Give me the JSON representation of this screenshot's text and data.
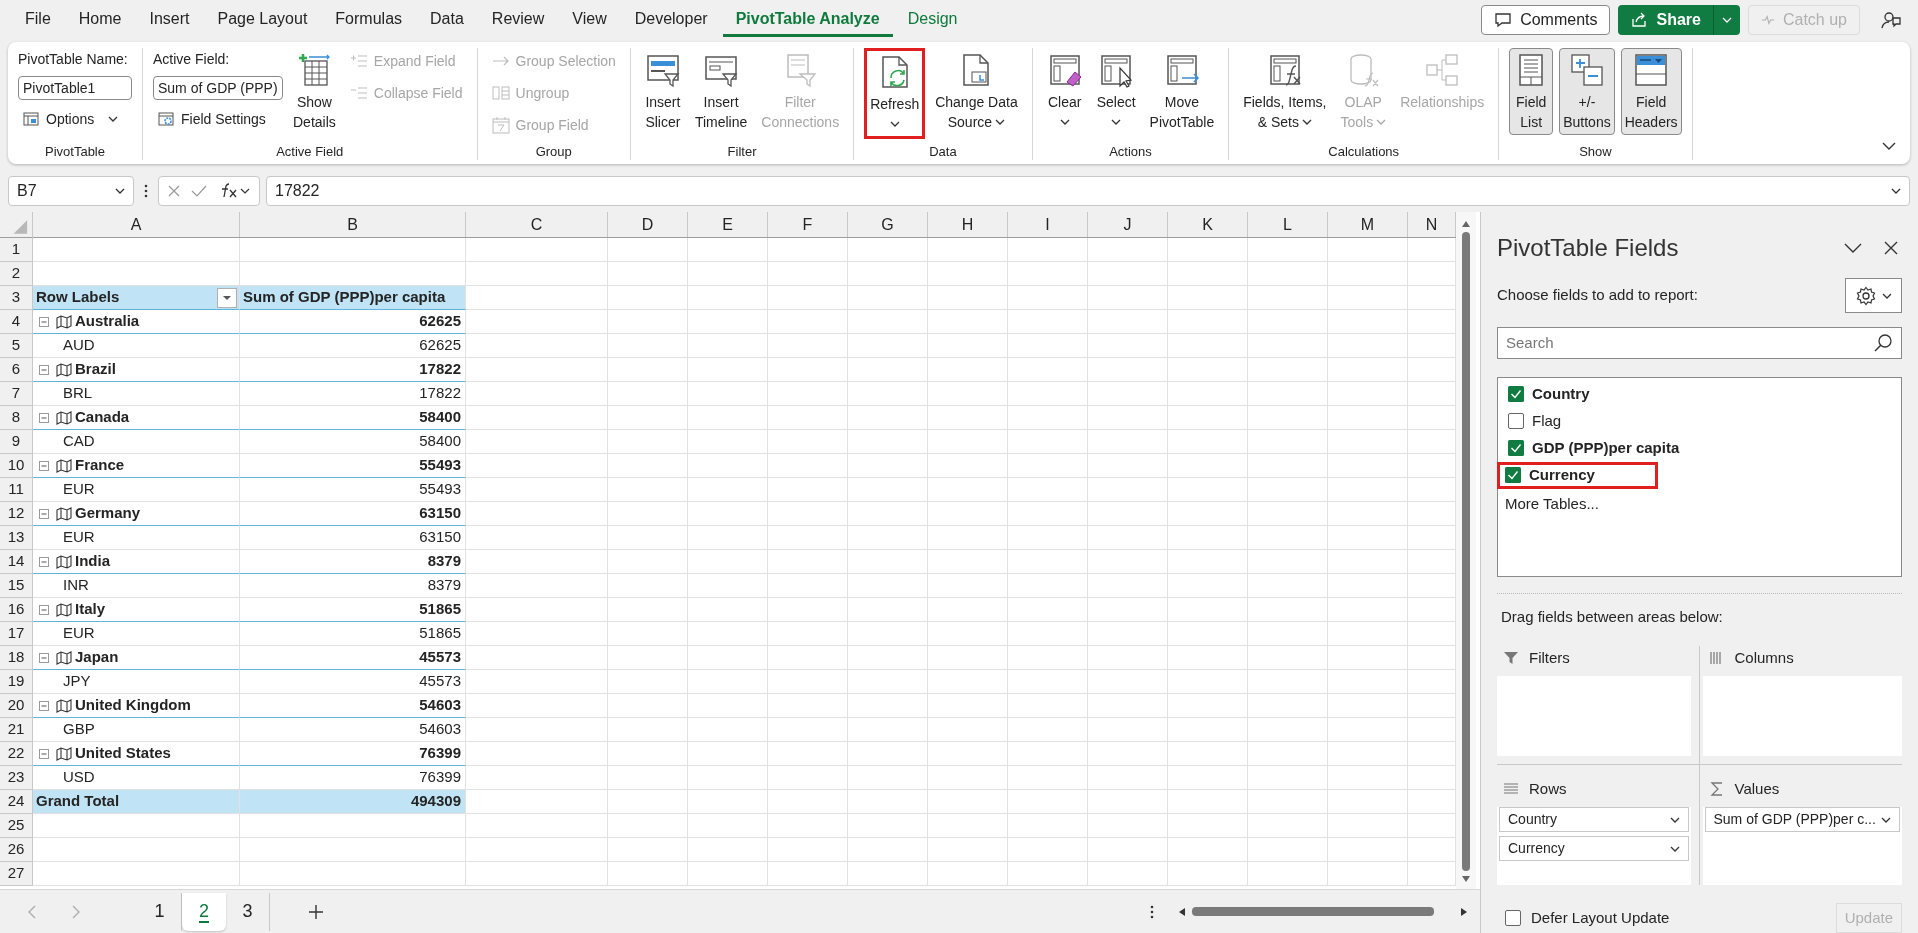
{
  "menu_tabs": [
    {
      "label": "File",
      "selected": false,
      "contextual": false
    },
    {
      "label": "Home",
      "selected": false,
      "contextual": false
    },
    {
      "label": "Insert",
      "selected": false,
      "contextual": false
    },
    {
      "label": "Page Layout",
      "selected": false,
      "contextual": false
    },
    {
      "label": "Formulas",
      "selected": false,
      "contextual": false
    },
    {
      "label": "Data",
      "selected": false,
      "contextual": false
    },
    {
      "label": "Review",
      "selected": false,
      "contextual": false
    },
    {
      "label": "View",
      "selected": false,
      "contextual": false
    },
    {
      "label": "Developer",
      "selected": false,
      "contextual": false
    },
    {
      "label": "PivotTable Analyze",
      "selected": true,
      "contextual": true
    },
    {
      "label": "Design",
      "selected": false,
      "contextual": true
    }
  ],
  "top_buttons": {
    "comments": "Comments",
    "share": "Share",
    "catch_up": {
      "label": "Catch up",
      "disabled": true
    }
  },
  "ribbon_groups": [
    {
      "label": "PivotTable",
      "columns": [
        [
          {
            "kind": "label",
            "text": "PivotTable Name:"
          },
          {
            "kind": "input",
            "value": "PivotTable1"
          },
          {
            "kind": "small",
            "label": "Options",
            "dropdown": true,
            "disabled": false
          }
        ]
      ]
    },
    {
      "label": "Active Field",
      "columns": [
        [
          {
            "kind": "label",
            "text": "Active Field:"
          },
          {
            "kind": "input",
            "value": "Sum of GDP (PPP)"
          },
          {
            "kind": "small",
            "label": "Field Settings",
            "dropdown": false,
            "disabled": false
          }
        ],
        [
          {
            "kind": "large",
            "lines": [
              "Show",
              "Details"
            ],
            "dropdown": false,
            "disabled": false,
            "selected": false,
            "highlighted": false
          }
        ],
        [
          {
            "kind": "small",
            "label": "Expand Field",
            "dropdown": false,
            "disabled": true
          },
          {
            "kind": "small",
            "label": "Collapse Field",
            "dropdown": false,
            "disabled": true
          }
        ]
      ]
    },
    {
      "label": "Group",
      "columns": [
        [
          {
            "kind": "small",
            "label": "Group Selection",
            "dropdown": false,
            "disabled": true
          },
          {
            "kind": "small",
            "label": "Ungroup",
            "dropdown": false,
            "disabled": true
          },
          {
            "kind": "small",
            "label": "Group Field",
            "dropdown": false,
            "disabled": true
          }
        ]
      ]
    },
    {
      "label": "Filter",
      "columns": [
        [
          {
            "kind": "large",
            "lines": [
              "Insert",
              "Slicer"
            ],
            "dropdown": false,
            "disabled": false,
            "selected": false,
            "highlighted": false
          }
        ],
        [
          {
            "kind": "large",
            "lines": [
              "Insert",
              "Timeline"
            ],
            "dropdown": false,
            "disabled": false,
            "selected": false,
            "highlighted": false
          }
        ],
        [
          {
            "kind": "large",
            "lines": [
              "Filter",
              "Connections"
            ],
            "dropdown": false,
            "disabled": true,
            "selected": false,
            "highlighted": false
          }
        ]
      ]
    },
    {
      "label": "Data",
      "columns": [
        [
          {
            "kind": "large",
            "lines": [
              "Refresh"
            ],
            "dropdown": true,
            "disabled": false,
            "selected": false,
            "highlighted": true
          }
        ],
        [
          {
            "kind": "large",
            "lines": [
              "Change Data",
              "Source"
            ],
            "dropdown": true,
            "disabled": false,
            "selected": false,
            "highlighted": false
          }
        ]
      ]
    },
    {
      "label": "Actions",
      "columns": [
        [
          {
            "kind": "large",
            "lines": [
              "Clear"
            ],
            "dropdown": true,
            "disabled": false,
            "selected": false,
            "highlighted": false
          }
        ],
        [
          {
            "kind": "large",
            "lines": [
              "Select"
            ],
            "dropdown": true,
            "disabled": false,
            "selected": false,
            "highlighted": false
          }
        ],
        [
          {
            "kind": "large",
            "lines": [
              "Move",
              "PivotTable"
            ],
            "dropdown": false,
            "disabled": false,
            "selected": false,
            "highlighted": false
          }
        ]
      ]
    },
    {
      "label": "Calculations",
      "columns": [
        [
          {
            "kind": "large",
            "lines": [
              "Fields, Items,",
              "& Sets"
            ],
            "dropdown": true,
            "disabled": false,
            "selected": false,
            "highlighted": false
          }
        ],
        [
          {
            "kind": "large",
            "lines": [
              "OLAP",
              "Tools"
            ],
            "dropdown": true,
            "disabled": true,
            "selected": false,
            "highlighted": false
          }
        ],
        [
          {
            "kind": "large",
            "lines": [
              "Relationships"
            ],
            "dropdown": false,
            "disabled": true,
            "selected": false,
            "highlighted": false
          }
        ]
      ]
    },
    {
      "label": "Show",
      "columns": [
        [
          {
            "kind": "large",
            "lines": [
              "Field",
              "List"
            ],
            "dropdown": false,
            "disabled": false,
            "selected": true,
            "highlighted": false
          }
        ],
        [
          {
            "kind": "large",
            "lines": [
              "+/-",
              "Buttons"
            ],
            "dropdown": false,
            "disabled": false,
            "selected": true,
            "highlighted": false
          }
        ],
        [
          {
            "kind": "large",
            "lines": [
              "Field",
              "Headers"
            ],
            "dropdown": false,
            "disabled": false,
            "selected": true,
            "highlighted": false
          }
        ]
      ]
    }
  ],
  "formula_bar": {
    "name_box": "B7",
    "formula": "17822"
  },
  "grid": {
    "columns": [
      "A",
      "B",
      "C",
      "D",
      "E",
      "F",
      "G",
      "H",
      "I",
      "J",
      "K",
      "L",
      "M",
      "N"
    ],
    "rows": [
      {
        "number": "1",
        "kind": "empty"
      },
      {
        "number": "2",
        "kind": "empty"
      },
      {
        "number": "3",
        "kind": "header",
        "a": "Row Labels",
        "b": "Sum of GDP (PPP)per capita"
      },
      {
        "number": "4",
        "kind": "country",
        "a": "Australia",
        "b": "62625",
        "expanded": true
      },
      {
        "number": "5",
        "kind": "item",
        "a": "AUD",
        "b": "62625"
      },
      {
        "number": "6",
        "kind": "country",
        "a": "Brazil",
        "b": "17822",
        "expanded": true
      },
      {
        "number": "7",
        "kind": "item",
        "a": "BRL",
        "b": "17822"
      },
      {
        "number": "8",
        "kind": "country",
        "a": "Canada",
        "b": "58400",
        "expanded": true
      },
      {
        "number": "9",
        "kind": "item",
        "a": "CAD",
        "b": "58400"
      },
      {
        "number": "10",
        "kind": "country",
        "a": "France",
        "b": "55493",
        "expanded": true
      },
      {
        "number": "11",
        "kind": "item",
        "a": "EUR",
        "b": "55493"
      },
      {
        "number": "12",
        "kind": "country",
        "a": "Germany",
        "b": "63150",
        "expanded": true
      },
      {
        "number": "13",
        "kind": "item",
        "a": "EUR",
        "b": "63150"
      },
      {
        "number": "14",
        "kind": "country",
        "a": "India",
        "b": "8379",
        "expanded": true
      },
      {
        "number": "15",
        "kind": "item",
        "a": "INR",
        "b": "8379"
      },
      {
        "number": "16",
        "kind": "country",
        "a": "Italy",
        "b": "51865",
        "expanded": true
      },
      {
        "number": "17",
        "kind": "item",
        "a": "EUR",
        "b": "51865"
      },
      {
        "number": "18",
        "kind": "country",
        "a": "Japan",
        "b": "45573",
        "expanded": true
      },
      {
        "number": "19",
        "kind": "item",
        "a": "JPY",
        "b": "45573"
      },
      {
        "number": "20",
        "kind": "country",
        "a": "United Kingdom",
        "b": "54603",
        "expanded": true
      },
      {
        "number": "21",
        "kind": "item",
        "a": "GBP",
        "b": "54603"
      },
      {
        "number": "22",
        "kind": "country",
        "a": "United States",
        "b": "76399",
        "expanded": true
      },
      {
        "number": "23",
        "kind": "item",
        "a": "USD",
        "b": "76399"
      },
      {
        "number": "24",
        "kind": "total",
        "a": "Grand Total",
        "b": "494309"
      },
      {
        "number": "25",
        "kind": "empty"
      },
      {
        "number": "26",
        "kind": "empty"
      },
      {
        "number": "27",
        "kind": "empty"
      }
    ]
  },
  "sheet_tabs": [
    {
      "label": "1",
      "selected": false
    },
    {
      "label": "2",
      "selected": true
    },
    {
      "label": "3",
      "selected": false
    }
  ],
  "pivot_pane": {
    "title": "PivotTable Fields",
    "subtitle": "Choose fields to add to report:",
    "search": {
      "placeholder": "Search"
    },
    "fields": [
      {
        "label": "Country",
        "checked": true,
        "highlighted": false
      },
      {
        "label": "Flag",
        "checked": false,
        "highlighted": false
      },
      {
        "label": "GDP (PPP)per capita",
        "checked": true,
        "highlighted": false
      },
      {
        "label": "Currency",
        "checked": true,
        "highlighted": true
      }
    ],
    "more_tables": "More Tables...",
    "drag_hint": "Drag fields between areas below:",
    "areas": [
      {
        "kind": "filters",
        "label": "Filters"
      },
      {
        "kind": "columns",
        "label": "Columns"
      },
      {
        "kind": "rows",
        "label": "Rows",
        "items": [
          "Country",
          "Currency"
        ]
      },
      {
        "kind": "values",
        "label": "Values",
        "items": [
          "Sum of GDP (PPP)per c..."
        ]
      }
    ],
    "defer": {
      "label": "Defer Layout Update",
      "checked": false
    },
    "update": {
      "label": "Update",
      "disabled": true
    }
  }
}
